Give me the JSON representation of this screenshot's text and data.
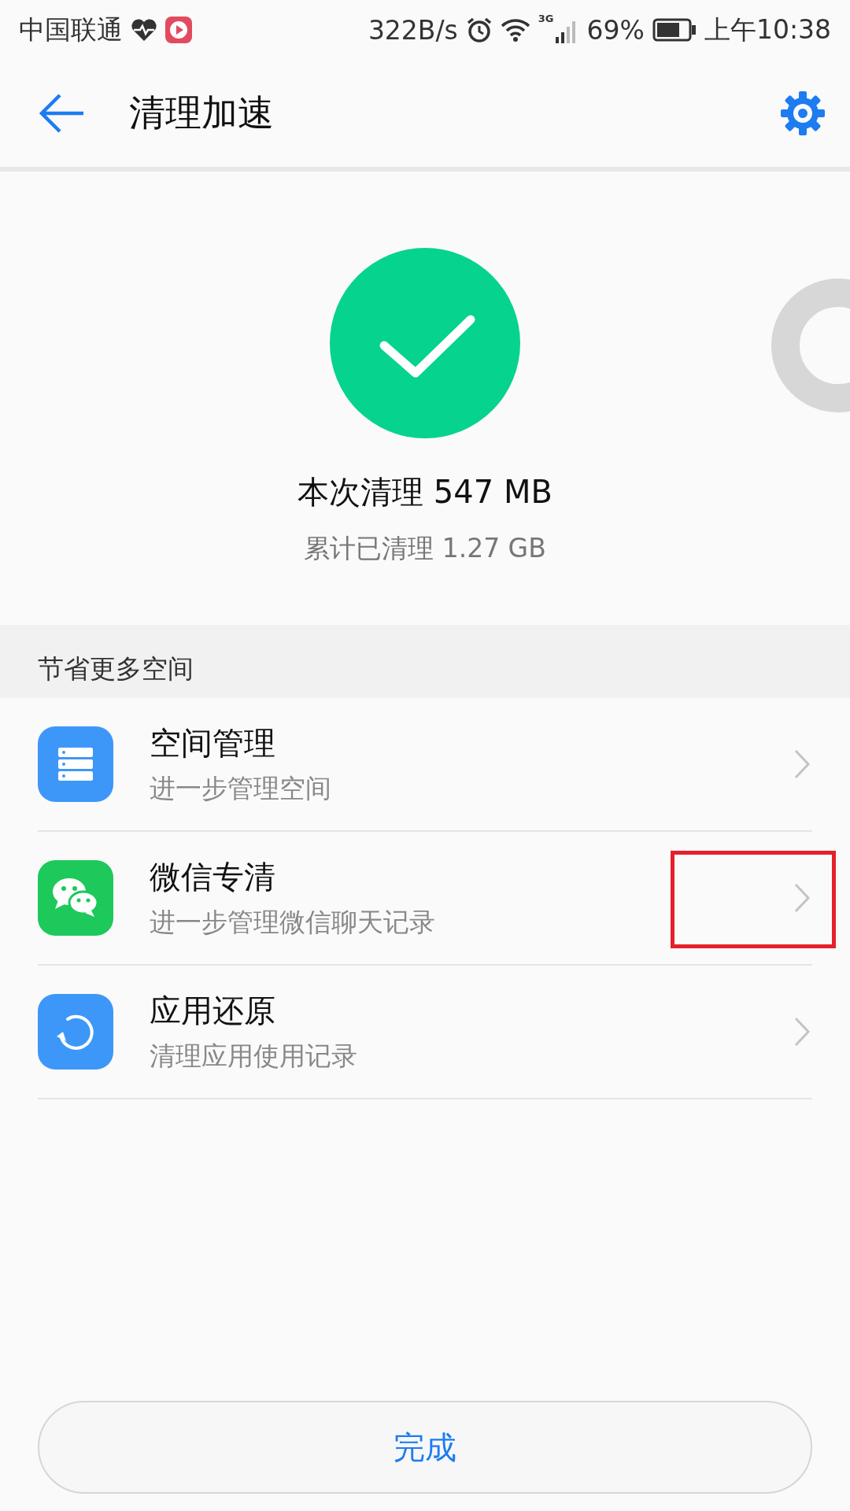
{
  "status_bar": {
    "carrier": "中国联通",
    "speed": "322B/s",
    "network": "3G",
    "battery": "69%",
    "time": "上午10:38"
  },
  "header": {
    "title": "清理加速"
  },
  "result": {
    "cleaned": "本次清理 547 MB",
    "total": "累计已清理 1.27 GB"
  },
  "section": {
    "title": "节省更多空间"
  },
  "items": [
    {
      "kind": "storage",
      "title": "空间管理",
      "subtitle": "进一步管理空间",
      "color": "#3d97f9",
      "highlighted": false
    },
    {
      "kind": "chat",
      "title": "微信专清",
      "subtitle": "进一步管理微信聊天记录",
      "color": "#1dc95a",
      "highlighted": true
    },
    {
      "kind": "restore",
      "title": "应用还原",
      "subtitle": "清理应用使用记录",
      "color": "#3d97f9",
      "highlighted": false
    }
  ],
  "done_button": "完成"
}
